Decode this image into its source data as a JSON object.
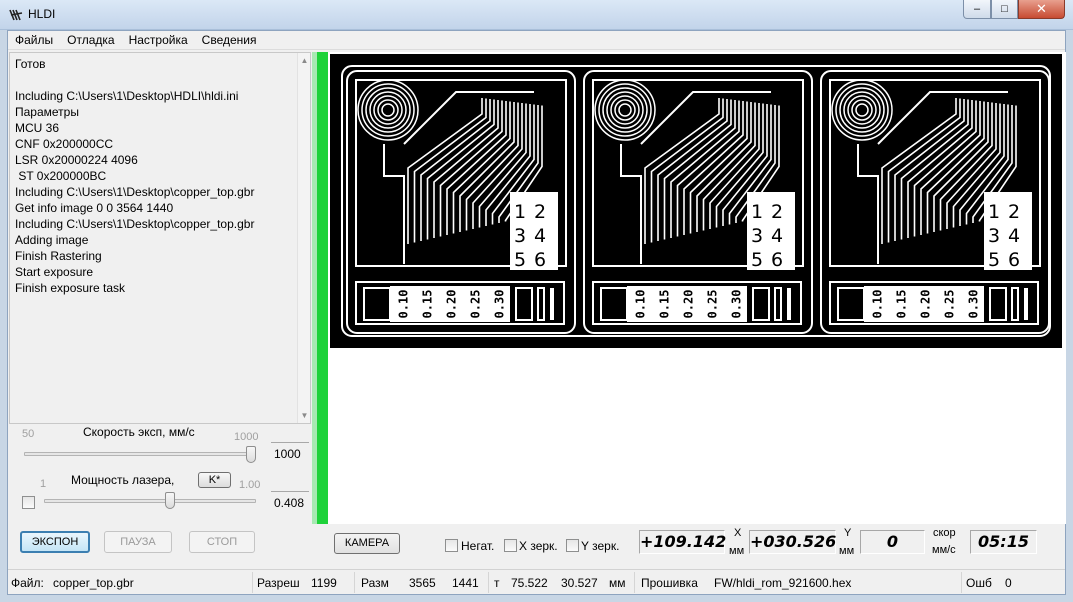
{
  "window": {
    "title": "HLDI",
    "minimize": "–",
    "maximize": "□",
    "close": "✕"
  },
  "menu": [
    "Файлы",
    "Отладка",
    "Настройка",
    "Сведения"
  ],
  "log": [
    "Готов",
    "",
    "Including C:\\Users\\1\\Desktop\\HDLI\\hldi.ini",
    "Параметры",
    "MCU 36",
    "CNF 0x200000CC",
    "LSR 0x20000224 4096",
    " ST 0x200000BC",
    "Including C:\\Users\\1\\Desktop\\copper_top.gbr",
    "Get info image 0 0 3564 1440",
    "Including C:\\Users\\1\\Desktop\\copper_top.gbr",
    "Adding image",
    "Finish Rastering",
    "Start exposure",
    "Finish exposure task"
  ],
  "speed": {
    "label": "Скорость эксп, мм/с",
    "min": "50",
    "max": "1000",
    "value": "1000",
    "level": 1.0
  },
  "power": {
    "label": "Мощность лазера,",
    "k_button": "K*",
    "min": "1",
    "max": "1.00",
    "value": "0.408",
    "level": 0.6
  },
  "buttons": {
    "expose": "ЭКСПОН",
    "pause": "ПАУЗА",
    "stop": "СТОП",
    "camera": "КАМЕРА"
  },
  "options": {
    "negative": "Негат.",
    "x_mirror": "X зерк.",
    "y_mirror": "Y зерк."
  },
  "position": {
    "x": "+109.142",
    "x_axis": "X",
    "x_unit": "мм",
    "y": "+030.526",
    "y_axis": "Y",
    "y_unit": "мм",
    "speed": "0",
    "speed_label_1": "скор",
    "speed_label_2": "мм/с",
    "time": "05:15"
  },
  "board": {
    "tiles": 3,
    "pad_digits": [
      [
        "1",
        "2"
      ],
      [
        "3",
        "4"
      ],
      [
        "5",
        "6"
      ]
    ],
    "trace_widths": [
      "0.10",
      "0.15",
      "0.20",
      "0.25",
      "0.30"
    ]
  },
  "status": {
    "file_label": "Файл:",
    "file": "copper_top.gbr",
    "res_label": "Разреш",
    "res": "1199",
    "size_label": "Разм",
    "size_w": "3565",
    "size_h": "1441",
    "t_label": "т",
    "t_w": "75.522",
    "t_h": "30.527",
    "t_unit": "мм",
    "fw_label": "Прошивка",
    "fw": "FW/hldi_rom_921600.hex",
    "err_label": "Ошб",
    "err": "0"
  },
  "colors": {
    "indicator": "#1ed23a",
    "primary_border": "#3c7fb1",
    "titlebar": "#c2d4ea",
    "close_button": "#c74b32"
  }
}
